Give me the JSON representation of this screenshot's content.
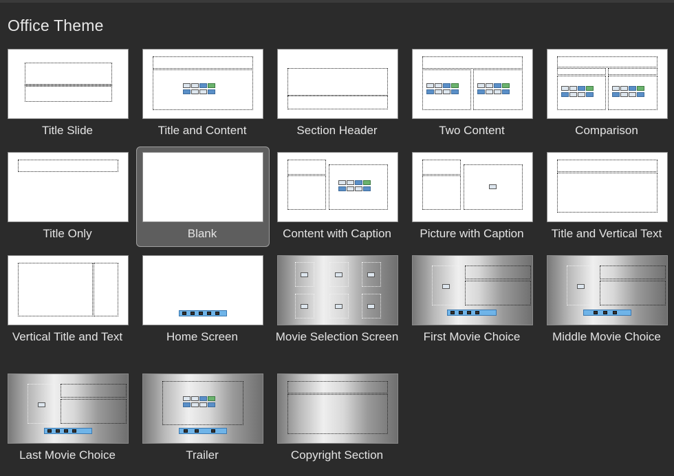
{
  "header": {
    "title": "Office Theme"
  },
  "layouts": [
    {
      "label": "Title Slide"
    },
    {
      "label": "Title and Content"
    },
    {
      "label": "Section Header"
    },
    {
      "label": "Two Content"
    },
    {
      "label": "Comparison"
    },
    {
      "label": "Title Only"
    },
    {
      "label": "Blank",
      "selected": true
    },
    {
      "label": "Content with Caption"
    },
    {
      "label": "Picture with Caption"
    },
    {
      "label": "Title and Vertical Text"
    },
    {
      "label": "Vertical Title and Text"
    },
    {
      "label": "Home Screen"
    },
    {
      "label": "Movie Selection Screen"
    },
    {
      "label": "First Movie Choice"
    },
    {
      "label": "Middle Movie Choice"
    },
    {
      "label": "Last Movie Choice"
    },
    {
      "label": "Trailer"
    },
    {
      "label": "Copyright Section"
    }
  ],
  "colors": {
    "background": "#2b2b2b",
    "selection": "#5e5e5e",
    "text": "#e4e4e4"
  }
}
